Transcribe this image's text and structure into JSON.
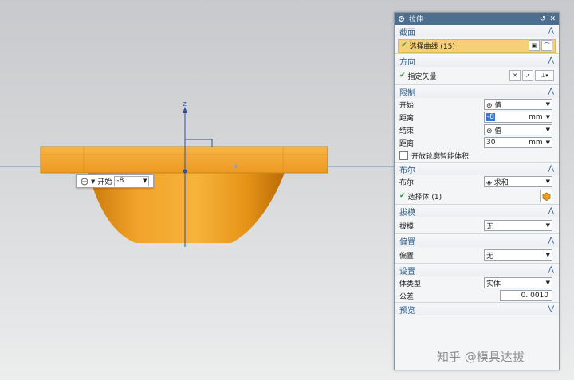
{
  "viewport": {
    "axis_label": "Z",
    "inline_widget": {
      "label": "开始",
      "value": "-8"
    }
  },
  "dialog": {
    "title": "拉伸",
    "sections": {
      "section_profile": {
        "title": "截面",
        "select_curve": "选择曲线 (15)"
      },
      "direction": {
        "title": "方向",
        "specify_vector": "指定矢量"
      },
      "limits": {
        "title": "限制",
        "start_label": "开始",
        "start_value": "值",
        "distance_label": "距离",
        "distance_value": "-8",
        "distance_unit": "mm",
        "end_label": "结束",
        "end_value": "值",
        "end_distance_label": "距离",
        "end_distance_value": "30",
        "end_distance_unit": "mm",
        "open_profile_label": "开放轮廓智能体积"
      },
      "boolean": {
        "title": "布尔",
        "boolean_label": "布尔",
        "boolean_value": "求和",
        "select_body": "选择体 (1)"
      },
      "draft": {
        "title": "拔模",
        "draft_label": "拔模",
        "draft_value": "无"
      },
      "offset": {
        "title": "偏置",
        "offset_label": "偏置",
        "offset_value": "无"
      },
      "settings": {
        "title": "设置",
        "body_type_label": "体类型",
        "body_type_value": "实体",
        "tolerance_label": "公差",
        "tolerance_value": "0. 0010"
      },
      "preview": {
        "title": "预览"
      }
    }
  },
  "watermark": "知乎 @模具达拔",
  "colors": {
    "accent": "#4d6f8f",
    "selection": "#f6d077",
    "part": "#f0a020",
    "section_title": "#2e5c8a"
  }
}
